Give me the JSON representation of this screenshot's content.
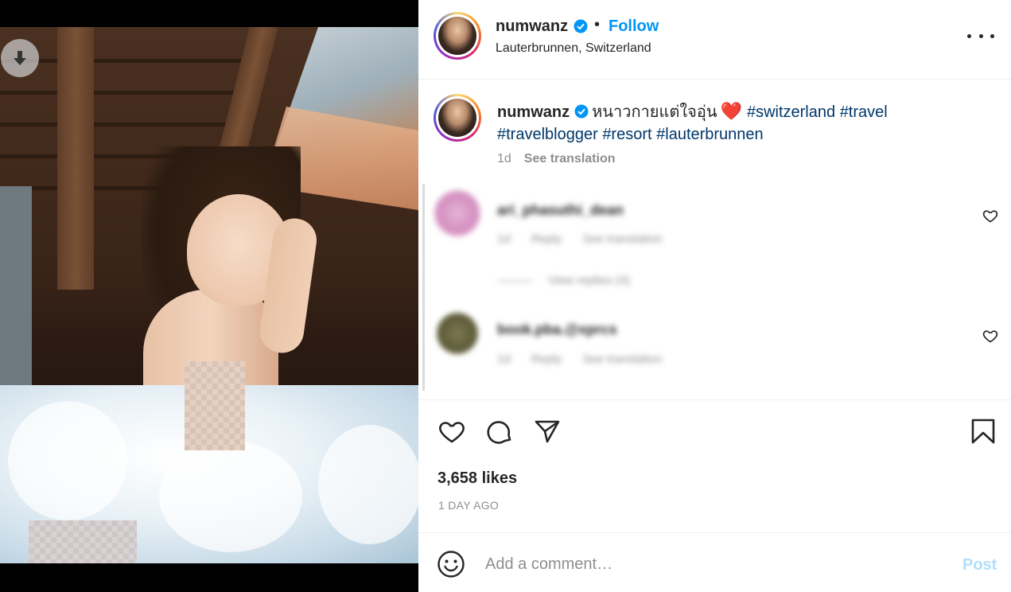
{
  "post": {
    "username": "numwanz",
    "follow_label": "Follow",
    "separator": "•",
    "location": "Lauterbrunnen, Switzerland"
  },
  "caption": {
    "username": "numwanz",
    "text": "หนาวกายแต่ใจอุ่น",
    "emoji": "❤️",
    "hashtags": [
      "#switzerland",
      "#travel",
      "#travelblogger",
      "#resort",
      "#lauterbrunnen"
    ],
    "age": "1d",
    "see_translation": "See translation"
  },
  "comments": [
    {
      "username": "ari_phasuthi_dean",
      "age": "1d",
      "reply": "Reply",
      "see_translation": "See translation",
      "view_replies": "View replies (4)"
    },
    {
      "username": "book.pba.@xprcs",
      "age": "1d",
      "reply": "Reply",
      "see_translation": "See translation"
    }
  ],
  "engagement": {
    "likes": "3,658 likes",
    "timestamp": "1 DAY AGO"
  },
  "composer": {
    "placeholder": "Add a comment…",
    "post_label": "Post"
  },
  "colors": {
    "accent": "#0095f6",
    "hashtag": "#00376b",
    "muted": "#8e8e8e",
    "post_disabled": "#b2dffc",
    "verified": "#0095f6"
  },
  "icons": [
    "download-icon",
    "verified-badge-icon",
    "more-options-icon",
    "heart-icon",
    "comment-icon",
    "share-icon",
    "bookmark-icon",
    "emoji-icon"
  ]
}
